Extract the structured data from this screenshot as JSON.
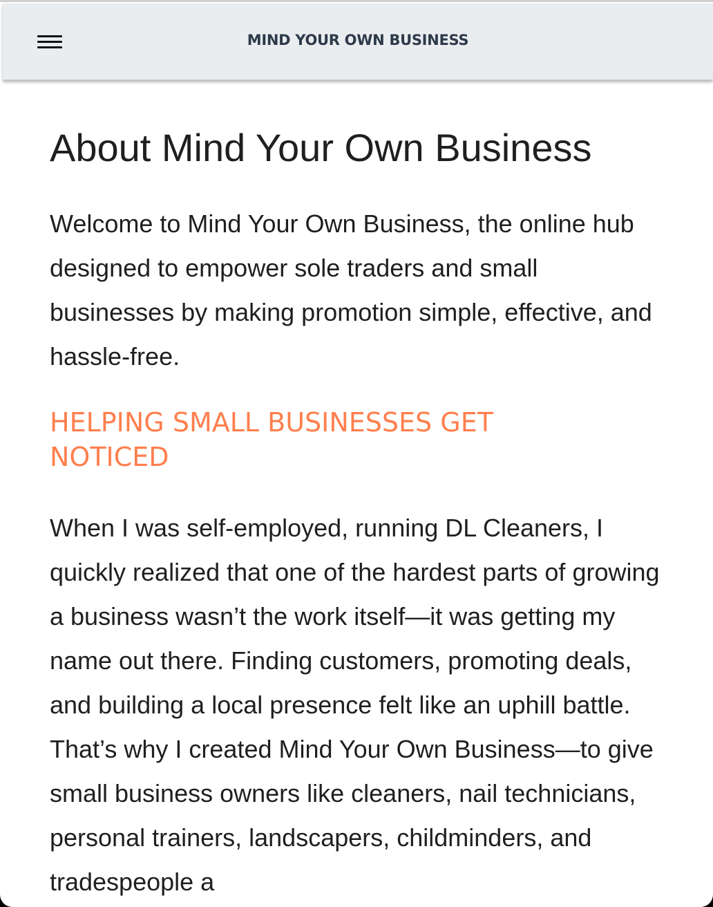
{
  "navbar": {
    "brand": "MIND YOUR OWN BUSINESS",
    "menu_icon": "hamburger-menu-icon",
    "background": "#e9edf0",
    "brand_color": "#2e3a4a"
  },
  "main": {
    "title": "About Mind Your Own Business",
    "intro": "Welcome to Mind Your Own Business, the online hub designed to empower sole traders and small businesses by making promotion simple, effective, and hassle-free.",
    "section_heading": "HELPING SMALL BUSINESSES GET NOTICED",
    "section_heading_color": "#ff7f4d",
    "story": "When I was self-employed, running DL Cleaners, I quickly realized that one of the hardest parts of growing a business wasn’t the work itself—it was getting my name out there. Finding customers, promoting deals, and building a local presence felt like an uphill battle. That’s why I created Mind Your Own Business—to give small business owners like cleaners, nail technicians, personal trainers, landscapers, childminders, and tradespeople a"
  }
}
